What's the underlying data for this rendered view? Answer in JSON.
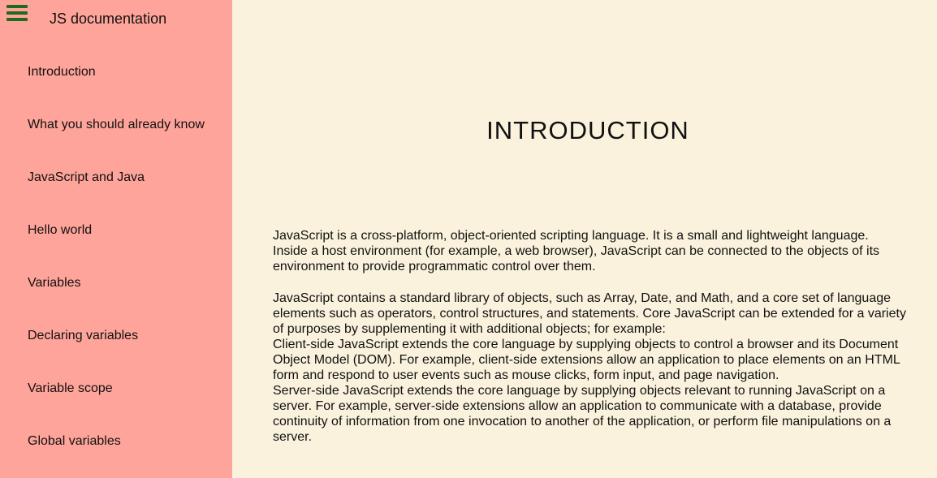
{
  "sidebar": {
    "title": "JS documentation",
    "menu_icon": "hamburger-icon",
    "items": [
      {
        "label": "Introduction"
      },
      {
        "label": "What you should already know"
      },
      {
        "label": "JavaScript and Java"
      },
      {
        "label": "Hello world"
      },
      {
        "label": "Variables"
      },
      {
        "label": "Declaring variables"
      },
      {
        "label": "Variable scope"
      },
      {
        "label": "Global variables"
      }
    ]
  },
  "main": {
    "section_title": "INTRODUCTION",
    "paragraphs": [
      "JavaScript is a cross-platform, object-oriented scripting language. It is a small and lightweight language. Inside a host environment (for example, a web browser), JavaScript can be connected to the objects of its environment to provide programmatic control over them.",
      "JavaScript contains a standard library of objects, such as Array, Date, and Math, and a core set of language elements such as operators, control structures, and statements. Core JavaScript can be extended for a variety of purposes by supplementing it with additional objects; for example:",
      "Client-side JavaScript extends the core language by supplying objects to control a browser and its Document Object Model (DOM). For example, client-side extensions allow an application to place elements on an HTML form and respond to user events such as mouse clicks, form input, and page navigation.",
      "Server-side JavaScript extends the core language by supplying objects relevant to running JavaScript on a server. For example, server-side extensions allow an application to communicate with a database, provide continuity of information from one invocation to another of the application, or perform file manipulations on a server."
    ]
  },
  "colors": {
    "sidebar_bg": "#ffa49a",
    "main_bg": "#faf2dc",
    "menu_icon": "#1f6a1f"
  }
}
